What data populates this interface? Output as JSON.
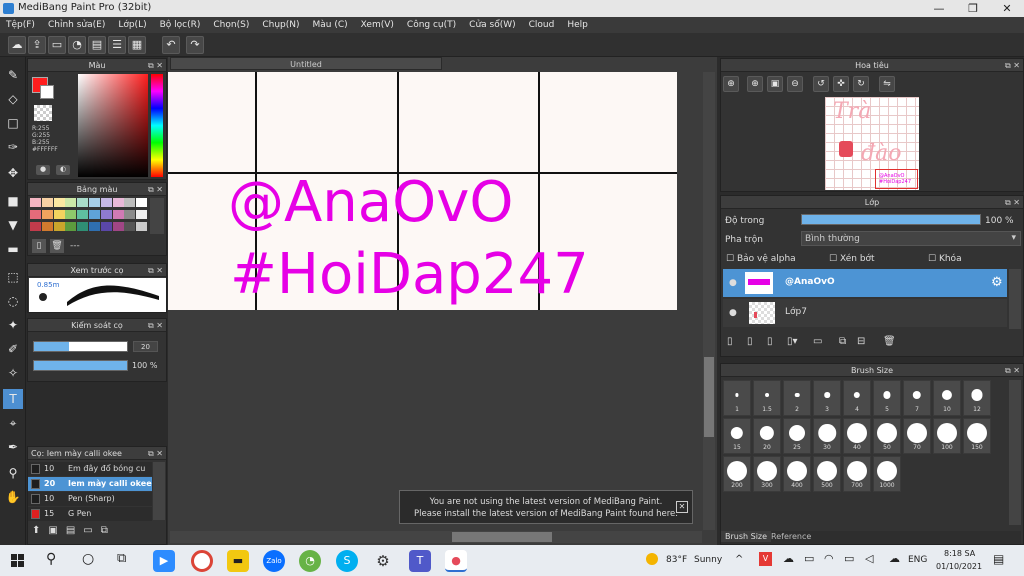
{
  "window": {
    "title": "MediBang Paint Pro (32bit)",
    "min": "—",
    "max": "❐",
    "close": "✕"
  },
  "menu": [
    "Tệp(F)",
    "Chỉnh sửa(E)",
    "Lớp(L)",
    "Bộ lọc(R)",
    "Chọn(S)",
    "Chụp(N)",
    "Màu (C)",
    "Xem(V)",
    "Công cụ(T)",
    "Cửa sổ(W)",
    "Cloud",
    "Help"
  ],
  "document": {
    "tab": "Untitled",
    "text_line1": "@AnaOvO",
    "text_line2": "#HoiDap247"
  },
  "color_panel": {
    "title": "Màu",
    "r": "R:255",
    "g": "G:255",
    "b": "B:255",
    "hex": "#FFFFFF",
    "fg_color": "#ff1e1e",
    "bg_color": "#ffffff"
  },
  "palette_panel": {
    "title": "Bảng màu",
    "name": "---"
  },
  "brush_preview": {
    "title": "Xem trước cọ",
    "size_label": "0.85m"
  },
  "brush_control": {
    "title": "Kiểm soát cọ",
    "size_value": "20",
    "opacity_value": "100 %",
    "size_fraction": 0.38,
    "opacity_fraction": 1.0
  },
  "brush_list": {
    "title": "Cọ: Iem mày calli okee",
    "items": [
      {
        "size": "10",
        "name": "Em đây đổ bóng cu",
        "color": "#1e1e1e"
      },
      {
        "size": "20",
        "name": "Iem mày calli okee",
        "color": "#1e1e1e"
      },
      {
        "size": "10",
        "name": "Pen (Sharp)",
        "color": "#1e1e1e"
      },
      {
        "size": "15",
        "name": "G Pen",
        "color": "#e02020"
      }
    ]
  },
  "navigator": {
    "title": "Hoa tiêu",
    "thumb_line1": "Trà",
    "thumb_line2": "đào",
    "thumb_tag1": "@AnaOvO",
    "thumb_tag2": "#HoiDap247"
  },
  "layer_panel": {
    "title": "Lớp",
    "opacity_label": "Độ trong",
    "opacity_value": "100 %",
    "opacity_fraction": 1.0,
    "blend_label": "Pha trộn",
    "blend_value": "Bình thường",
    "protect_alpha": "Bảo vệ alpha",
    "clipping": "Xén bớt",
    "lock": "Khóa",
    "layers": [
      {
        "name": "@AnaOvO",
        "selected": true
      },
      {
        "name": "Lớp7",
        "selected": false
      }
    ]
  },
  "brush_size_panel": {
    "title": "Brush Size",
    "sizes": [
      "1",
      "1.5",
      "2",
      "3",
      "4",
      "5",
      "7",
      "10",
      "12",
      "15",
      "20",
      "25",
      "30",
      "40",
      "50",
      "70",
      "100",
      "150",
      "200",
      "300",
      "400",
      "500",
      "700",
      "1000"
    ],
    "tabs": [
      "Brush Size",
      "Reference"
    ]
  },
  "notice": {
    "line1": "You are not using the latest version of MediBang Paint.",
    "line2": "Please install the latest version of MediBang Paint found here.",
    "close": "✕"
  },
  "taskbar": {
    "weather_temp": "83°F",
    "weather_text": "Sunny",
    "lang": "ENG",
    "time": "8:18 SA",
    "date": "01/10/2021"
  }
}
